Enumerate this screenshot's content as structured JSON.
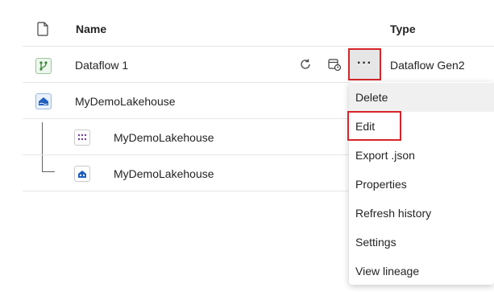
{
  "header": {
    "name_label": "Name",
    "type_label": "Type"
  },
  "rows": [
    {
      "name": "Dataflow 1",
      "type": "Dataflow Gen2",
      "icon": "dataflow-icon"
    },
    {
      "name": "MyDemoLakehouse",
      "type": "",
      "icon": "lakehouse-icon"
    },
    {
      "name": "MyDemoLakehouse",
      "type": "",
      "icon": "semantic-model-icon"
    },
    {
      "name": "MyDemoLakehouse",
      "type": "",
      "icon": "sql-endpoint-icon"
    }
  ],
  "row_actions": {
    "refresh": "refresh-icon",
    "schedule": "schedule-icon",
    "more": "···"
  },
  "context_menu": {
    "items": [
      "Delete",
      "Edit",
      "Export .json",
      "Properties",
      "Refresh history",
      "Settings",
      "View lineage"
    ]
  },
  "colors": {
    "highlight": "#d6252a",
    "dataflow_green": "#3a8a3a",
    "lakehouse_blue": "#1f5fbf"
  }
}
